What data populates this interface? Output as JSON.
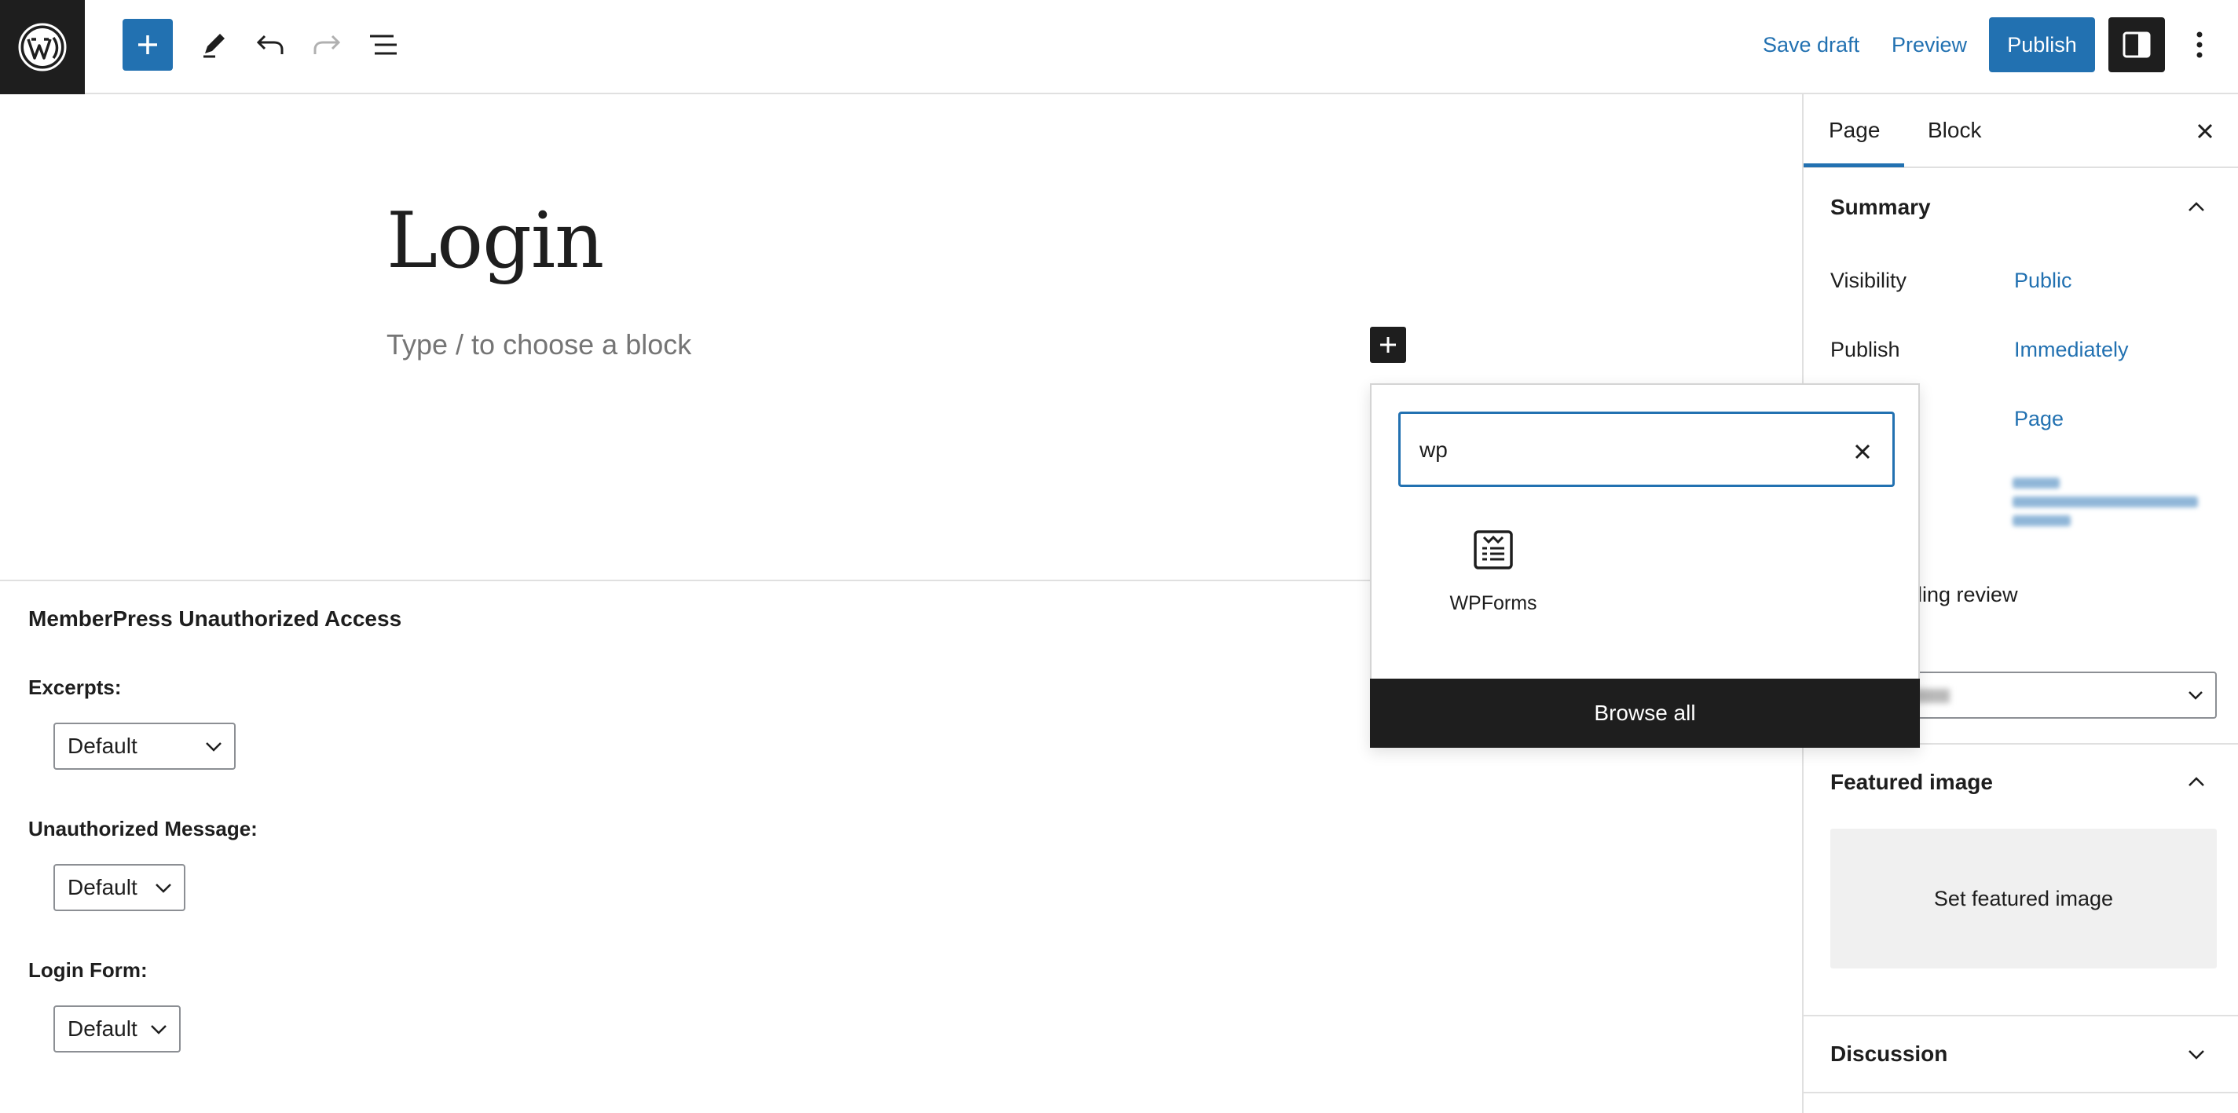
{
  "toolbar": {
    "save_draft_label": "Save draft",
    "preview_label": "Preview",
    "publish_label": "Publish"
  },
  "editor": {
    "page_title": "Login",
    "block_placeholder": "Type / to choose a block"
  },
  "inserter": {
    "search_value": "wp",
    "results": [
      {
        "label": "WPForms",
        "icon": "wpforms-icon"
      }
    ],
    "browse_all_label": "Browse all"
  },
  "metabox": {
    "title": "MemberPress Unauthorized Access",
    "fields": [
      {
        "label": "Excerpts:",
        "value": "Default"
      },
      {
        "label": "Unauthorized Message:",
        "value": "Default"
      },
      {
        "label": "Login Form:",
        "value": "Default"
      }
    ]
  },
  "sidebar": {
    "tabs": [
      "Page",
      "Block"
    ],
    "active_tab": "Page",
    "summary": {
      "title": "Summary",
      "visibility_label": "Visibility",
      "visibility_value": "Public",
      "publish_label": "Publish",
      "publish_value": "Immediately",
      "template_value": "Page",
      "pending_review_partial": "ding review"
    },
    "featured_image": {
      "title": "Featured image",
      "set_label": "Set featured image"
    },
    "discussion": {
      "title": "Discussion"
    }
  },
  "colors": {
    "accent": "#2271b1",
    "dark": "#1e1e1e",
    "border": "#e0e0e0"
  }
}
